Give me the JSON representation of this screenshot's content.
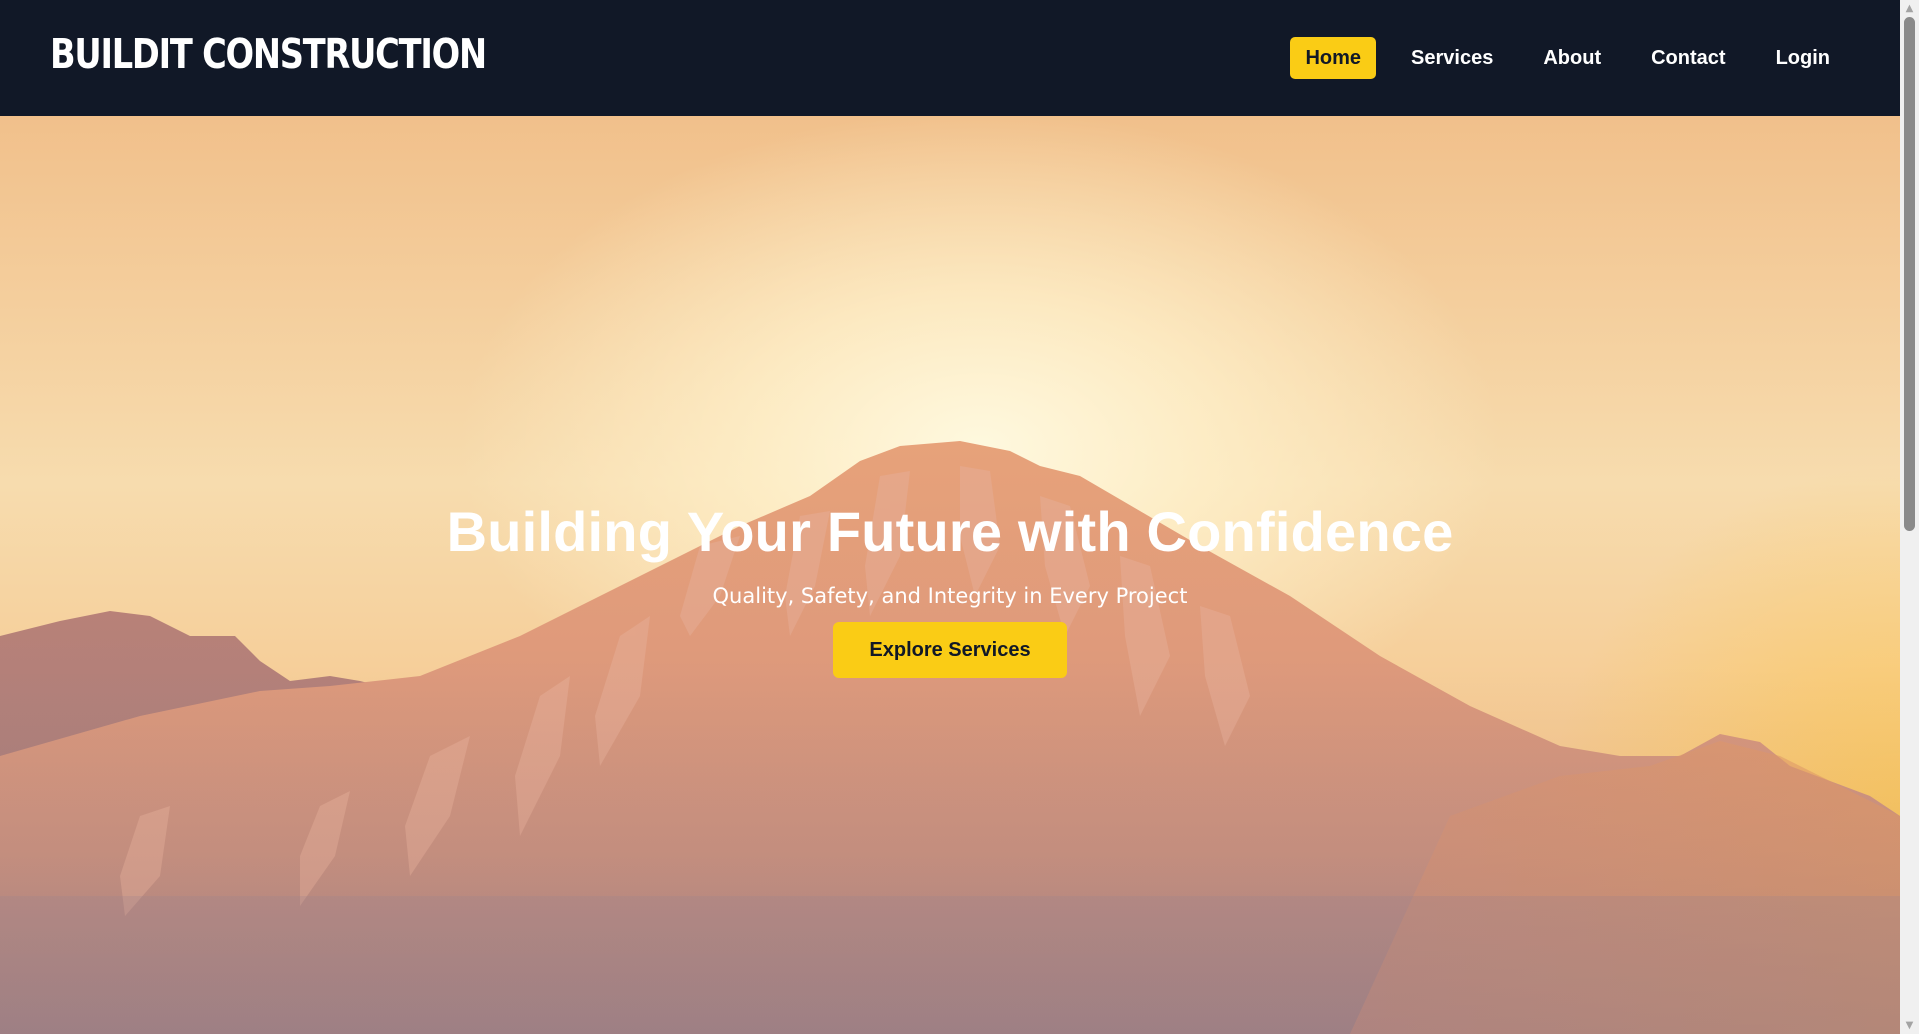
{
  "brand": {
    "name": "BUILDIT CONSTRUCTION"
  },
  "nav": {
    "items": [
      {
        "label": "Home",
        "active": true
      },
      {
        "label": "Services",
        "active": false
      },
      {
        "label": "About",
        "active": false
      },
      {
        "label": "Contact",
        "active": false
      },
      {
        "label": "Login",
        "active": false
      }
    ]
  },
  "hero": {
    "title": "Building Your Future with Confidence",
    "subtitle": "Quality, Safety, and Integrity in Every Project",
    "cta_label": "Explore Services",
    "background": "mountain-sunset-photo"
  },
  "colors": {
    "navbar_bg": "#111827",
    "accent": "#facc15",
    "text_light": "#ffffff",
    "text_dark": "#111827"
  },
  "icons": {
    "scroll_up": "scroll-up-arrow-icon",
    "scroll_down": "scroll-down-arrow-icon"
  }
}
